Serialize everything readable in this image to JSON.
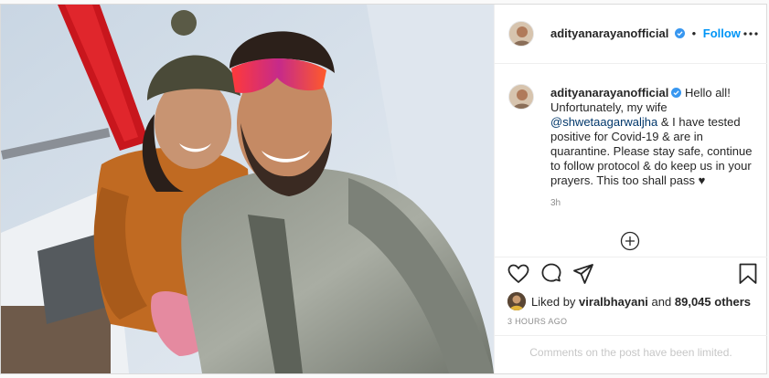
{
  "post": {
    "username": "adityanarayanofficial",
    "follow_label": "Follow",
    "separator": "•",
    "caption": {
      "username": "adityanarayanofficial",
      "text_before_mention": "Hello all! Unfortunately, my wife",
      "mention": "@shwetaagarwaljha",
      "text_after_mention": "& I have tested positive for Covid-19 & are in quarantine. Please stay safe, continue to follow protocol & do keep us in your prayers. This too shall pass",
      "heart": "♥",
      "time": "3h"
    },
    "likes": {
      "prefix": "Liked by",
      "liker": "viralbhayani",
      "middle": "and",
      "count": "89,045 others"
    },
    "timestamp": "3 HOURS AGO",
    "comments_notice": "Comments on the post have been limited."
  },
  "icons": {
    "verified": "verified-badge-icon",
    "more": "more-options-icon",
    "add_comment": "plus-circle-icon",
    "like": "heart-icon",
    "comment": "comment-bubble-icon",
    "share": "paper-plane-icon",
    "save": "bookmark-icon"
  },
  "colors": {
    "link_blue": "#0095f6",
    "mention": "#00376b",
    "muted": "#8e8e8e",
    "border": "#efefef"
  }
}
